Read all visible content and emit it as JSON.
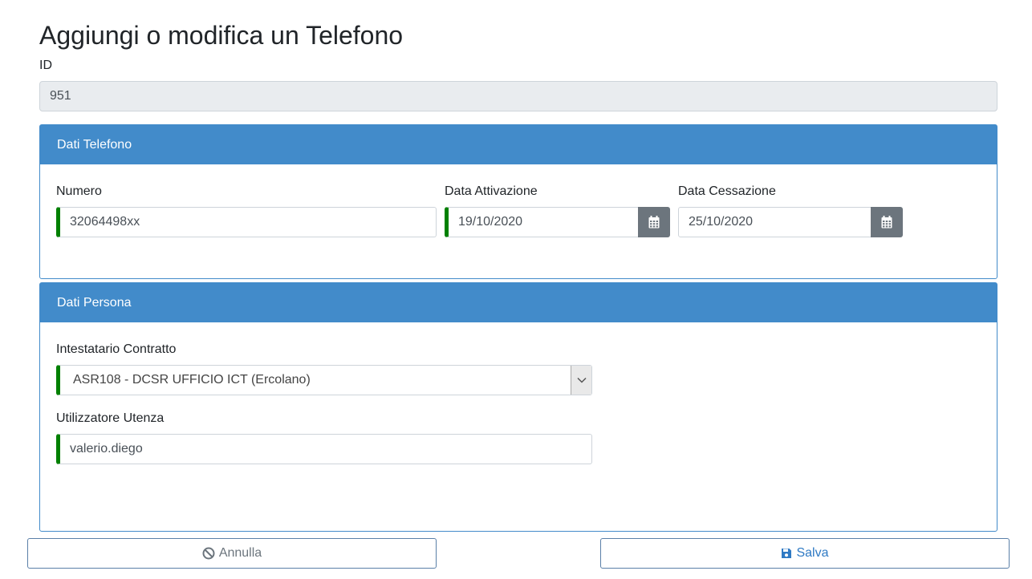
{
  "page": {
    "title": "Aggiungi o modifica un Telefono"
  },
  "id_field": {
    "label": "ID",
    "value": "951"
  },
  "card_telefono": {
    "header": "Dati Telefono",
    "numero": {
      "label": "Numero",
      "value": "32064498xx"
    },
    "data_attivazione": {
      "label": "Data Attivazione",
      "value": "19/10/2020",
      "icon": "calendar-icon"
    },
    "data_cessazione": {
      "label": "Data Cessazione",
      "value": "25/10/2020",
      "icon": "calendar-icon"
    }
  },
  "card_persona": {
    "header": "Dati Persona",
    "intestatario": {
      "label": "Intestatario Contratto",
      "value": "ASR108 - DCSR UFFICIO ICT (Ercolano)",
      "icon": "chevron-down-icon"
    },
    "utilizzatore": {
      "label": "Utilizzatore Utenza",
      "value": "valerio.diego"
    }
  },
  "buttons": {
    "annulla": {
      "label": "Annulla",
      "icon": "ban-icon"
    },
    "salva": {
      "label": "Salva",
      "icon": "save-icon"
    }
  },
  "colors": {
    "primary": "#428bca",
    "valid": "#008000",
    "addon": "#6c757d",
    "readonly_bg": "#e9ecef"
  }
}
